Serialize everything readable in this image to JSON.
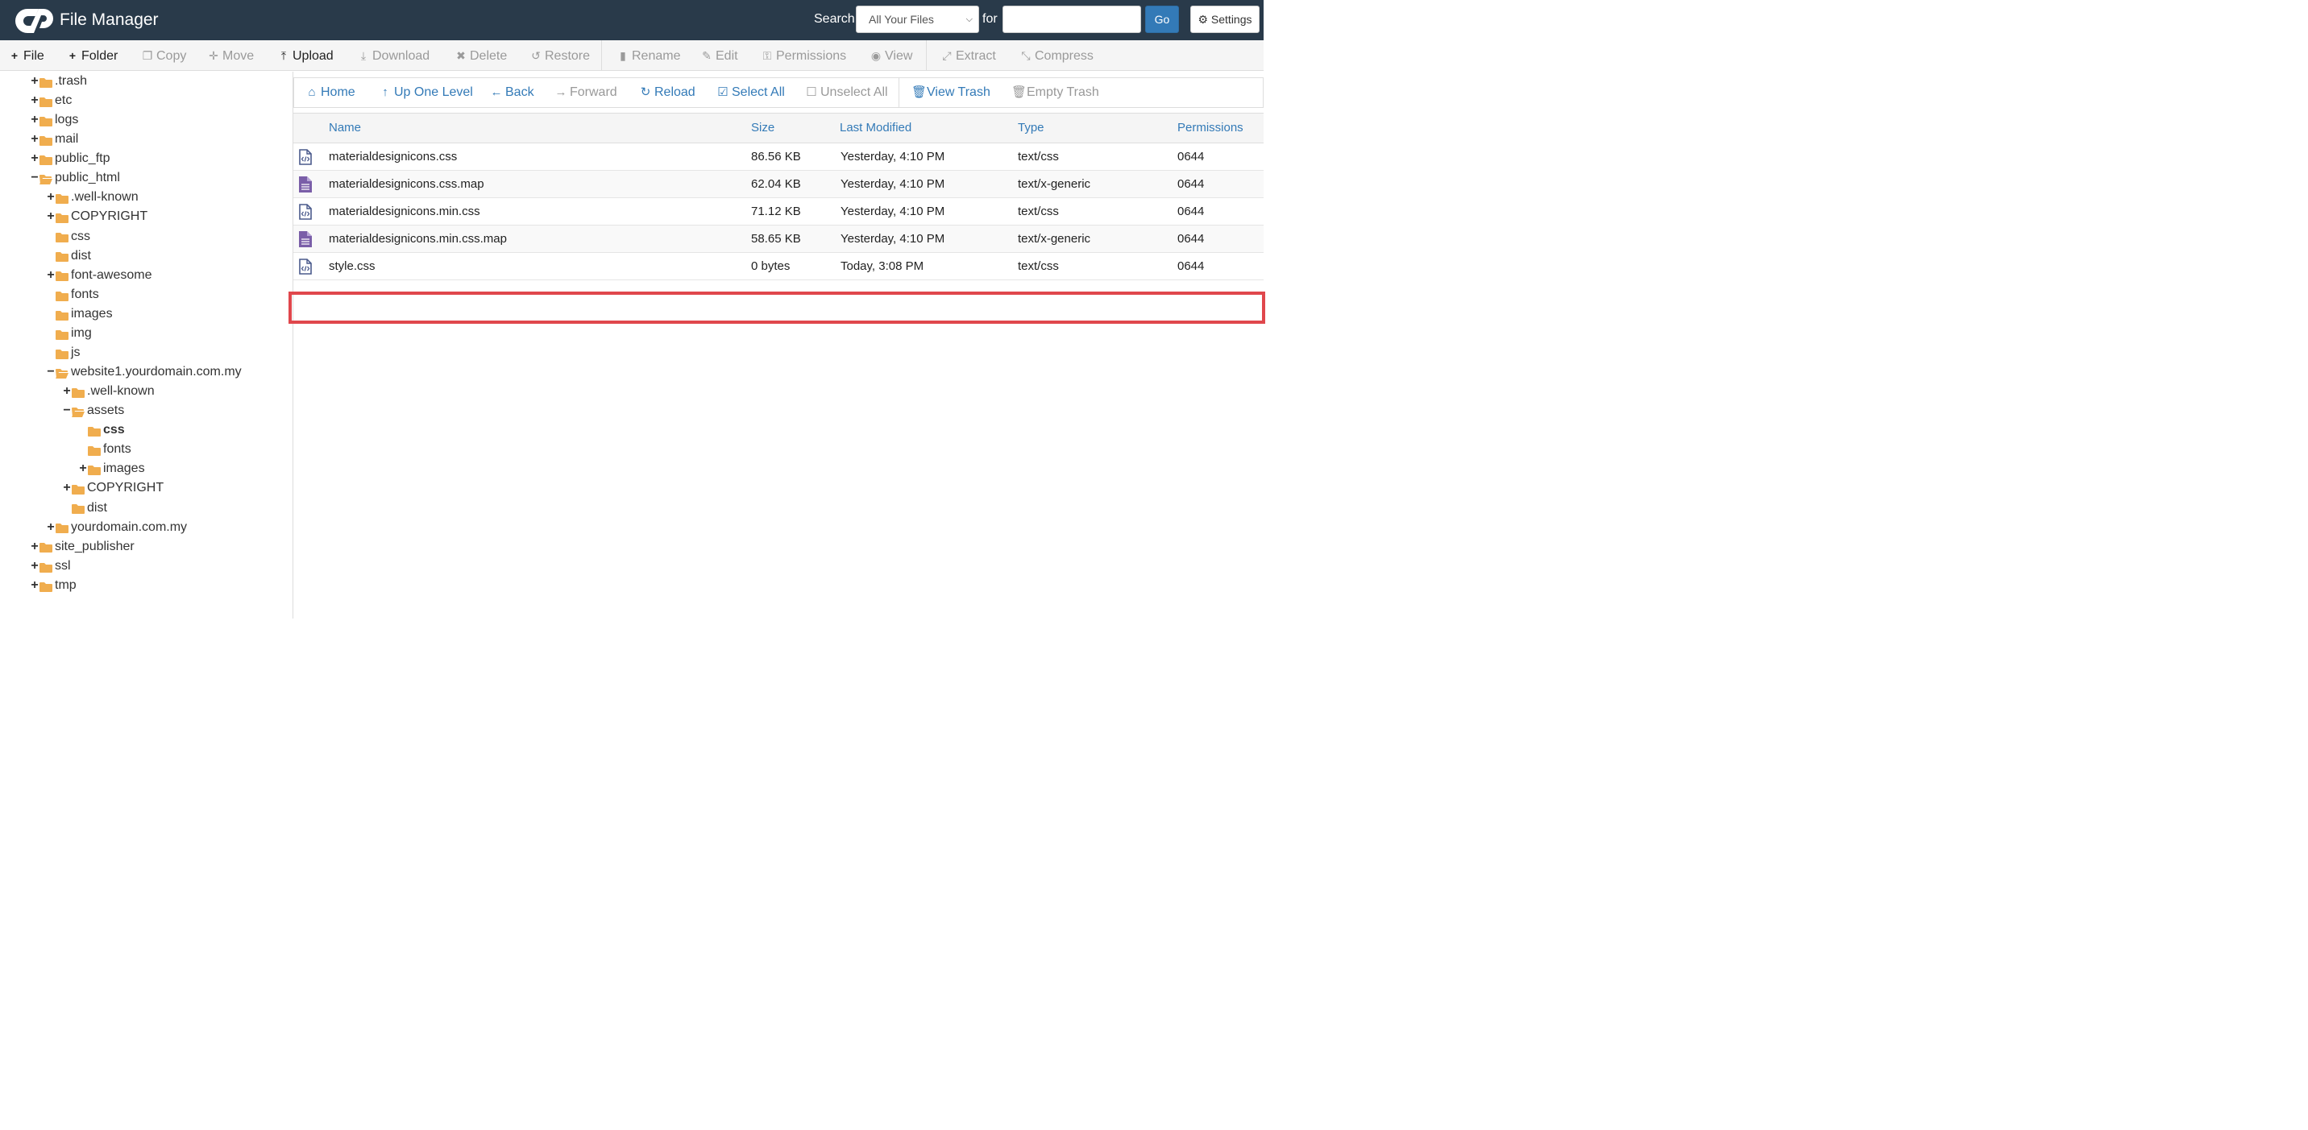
{
  "header": {
    "title": "File Manager",
    "search_label": "Search",
    "search_scope": "All Your Files",
    "for_label": "for",
    "search_value": "",
    "go_label": "Go",
    "settings_label": "Settings",
    "background_color": "#293a4a"
  },
  "toolbar": {
    "file": "File",
    "folder": "Folder",
    "copy": "Copy",
    "move": "Move",
    "upload": "Upload",
    "download": "Download",
    "delete": "Delete",
    "restore": "Restore",
    "rename": "Rename",
    "edit": "Edit",
    "permissions": "Permissions",
    "view": "View",
    "extract": "Extract",
    "compress": "Compress"
  },
  "navbar": {
    "home": "Home",
    "up_one_level": "Up One Level",
    "back": "Back",
    "forward": "Forward",
    "reload": "Reload",
    "select_all": "Select All",
    "unselect_all": "Unselect All",
    "view_trash": "View Trash",
    "empty_trash": "Empty Trash",
    "link_color": "#337ab7"
  },
  "tree": [
    {
      "label": ".trash",
      "toggle": "+",
      "open": false
    },
    {
      "label": "etc",
      "toggle": "+",
      "open": false
    },
    {
      "label": "logs",
      "toggle": "+",
      "open": false
    },
    {
      "label": "mail",
      "toggle": "+",
      "open": false
    },
    {
      "label": "public_ftp",
      "toggle": "+",
      "open": false
    },
    {
      "label": "public_html",
      "toggle": "−",
      "open": true
    },
    {
      "label": ".well-known",
      "toggle": "+",
      "open": false
    },
    {
      "label": "COPYRIGHT",
      "toggle": "+",
      "open": false
    },
    {
      "label": "css",
      "toggle": "",
      "open": false
    },
    {
      "label": "dist",
      "toggle": "",
      "open": false
    },
    {
      "label": "font-awesome",
      "toggle": "+",
      "open": false
    },
    {
      "label": "fonts",
      "toggle": "",
      "open": false
    },
    {
      "label": "images",
      "toggle": "",
      "open": false
    },
    {
      "label": "img",
      "toggle": "",
      "open": false
    },
    {
      "label": "js",
      "toggle": "",
      "open": false
    },
    {
      "label": "website1.yourdomain.com.my",
      "toggle": "−",
      "open": true
    },
    {
      "label": ".well-known",
      "toggle": "+",
      "open": false
    },
    {
      "label": "assets",
      "toggle": "−",
      "open": true
    },
    {
      "label": "css",
      "toggle": "",
      "open": false,
      "selected": true
    },
    {
      "label": "fonts",
      "toggle": "",
      "open": false
    },
    {
      "label": "images",
      "toggle": "+",
      "open": false
    },
    {
      "label": "COPYRIGHT",
      "toggle": "+",
      "open": false
    },
    {
      "label": "dist",
      "toggle": "",
      "open": false
    },
    {
      "label": "yourdomain.com.my",
      "toggle": "+",
      "open": false
    },
    {
      "label": "site_publisher",
      "toggle": "+",
      "open": false
    },
    {
      "label": "ssl",
      "toggle": "+",
      "open": false
    },
    {
      "label": "tmp",
      "toggle": "+",
      "open": false
    }
  ],
  "table": {
    "columns": {
      "name": "Name",
      "size": "Size",
      "modified": "Last Modified",
      "type": "Type",
      "permissions": "Permissions"
    },
    "rows": [
      {
        "icon": "code-file-icon",
        "name": "materialdesignicons.css",
        "size": "86.56 KB",
        "modified": "Yesterday, 4:10 PM",
        "type": "text/css",
        "permissions": "0644"
      },
      {
        "icon": "text-file-icon",
        "name": "materialdesignicons.css.map",
        "size": "62.04 KB",
        "modified": "Yesterday, 4:10 PM",
        "type": "text/x-generic",
        "permissions": "0644"
      },
      {
        "icon": "code-file-icon",
        "name": "materialdesignicons.min.css",
        "size": "71.12 KB",
        "modified": "Yesterday, 4:10 PM",
        "type": "text/css",
        "permissions": "0644"
      },
      {
        "icon": "text-file-icon",
        "name": "materialdesignicons.min.css.map",
        "size": "58.65 KB",
        "modified": "Yesterday, 4:10 PM",
        "type": "text/x-generic",
        "permissions": "0644"
      },
      {
        "icon": "code-file-icon",
        "name": "style.css",
        "size": "0 bytes",
        "modified": "Today, 3:08 PM",
        "type": "text/css",
        "permissions": "0644",
        "highlighted": true
      }
    ],
    "highlight_color": "#e0474c"
  }
}
